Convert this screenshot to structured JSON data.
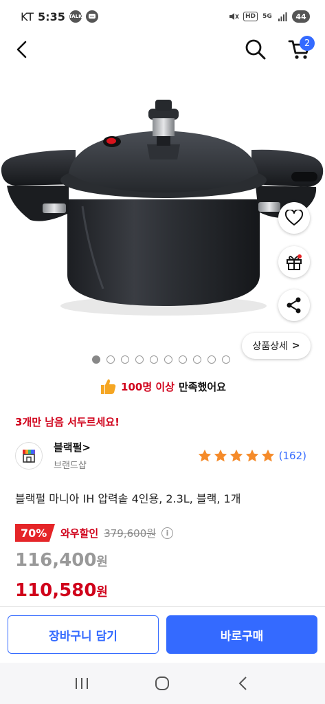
{
  "status_bar": {
    "carrier": "KT",
    "time": "5:35",
    "notif_talk": "TALK",
    "hd_label": "HD",
    "network": "5G",
    "battery": "44"
  },
  "header": {
    "cart_count": "2"
  },
  "product_image": {
    "alt": "블랙펄 압력솥"
  },
  "side_actions": {
    "detail_label": "상품상세",
    "detail_chevron": ">"
  },
  "carousel": {
    "total": 10,
    "active": 0
  },
  "satisfaction": {
    "count_text": "100명 이상",
    "suffix": "만족했어요"
  },
  "stock_alert": "3개만 남음 서두르세요!",
  "seller": {
    "name": "블랙펄>",
    "type": "브랜드샵",
    "rating_stars": 5,
    "review_count": "(162)"
  },
  "product_title": "블랙펄 마니아 IH 압력솥 4인용, 2.3L, 블랙, 1개",
  "price": {
    "discount_rate": "70%",
    "wow_label": "와우할인",
    "original_price": "379,600원",
    "info_icon": "i",
    "sale_price": "116,400",
    "wow_price": "110,580",
    "currency": "원"
  },
  "actions": {
    "cart_label": "장바구니 담기",
    "buy_label": "바로구매"
  },
  "colors": {
    "accent_blue": "#346aff",
    "sale_red": "#d0021b",
    "badge_red": "#e52528",
    "star_orange": "#f58b2a"
  }
}
